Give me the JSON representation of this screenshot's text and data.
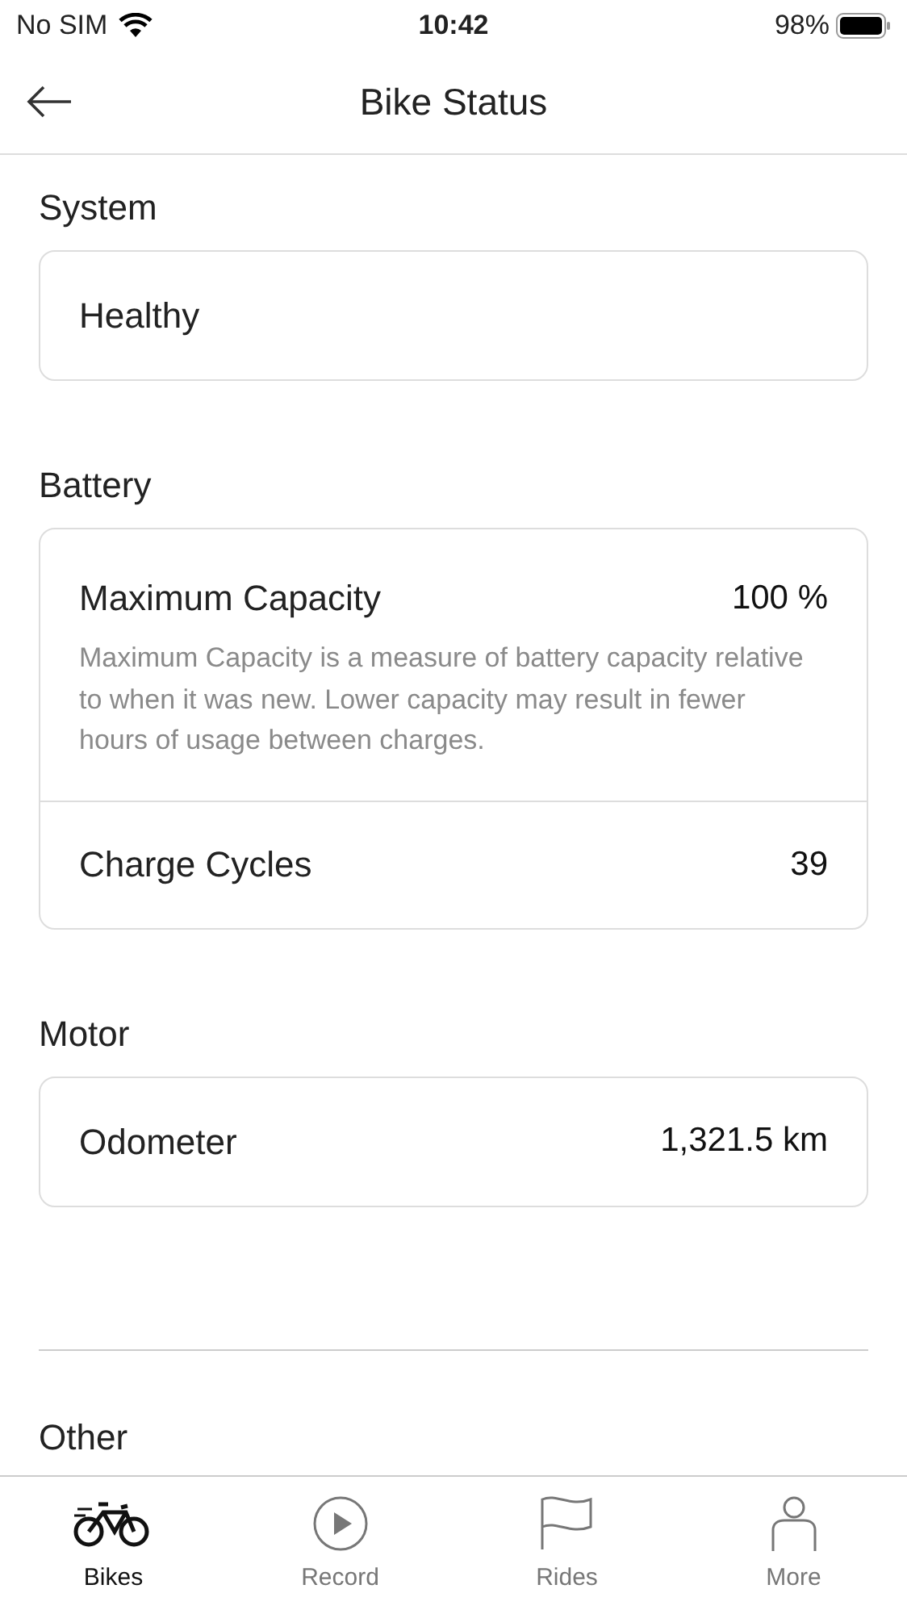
{
  "status_bar": {
    "carrier": "No SIM",
    "time": "10:42",
    "battery": "98%"
  },
  "header": {
    "title": "Bike Status"
  },
  "sections": [
    {
      "title": "System",
      "rows": [
        {
          "label": "Healthy"
        }
      ]
    },
    {
      "title": "Battery",
      "rows": [
        {
          "label": "Maximum Capacity",
          "value": "100 %",
          "description": "Maximum Capacity is a measure of battery capacity relative to when it was new. Lower capacity may result in fewer hours of usage between charges."
        },
        {
          "label": "Charge Cycles",
          "value": "39"
        }
      ]
    },
    {
      "title": "Motor",
      "rows": [
        {
          "label": "Odometer",
          "value": "1,321.5 km"
        }
      ]
    },
    {
      "title": "Other"
    }
  ],
  "tabs": [
    {
      "label": "Bikes",
      "selected": true
    },
    {
      "label": "Record",
      "selected": false
    },
    {
      "label": "Rides",
      "selected": false
    },
    {
      "label": "More",
      "selected": false
    }
  ]
}
